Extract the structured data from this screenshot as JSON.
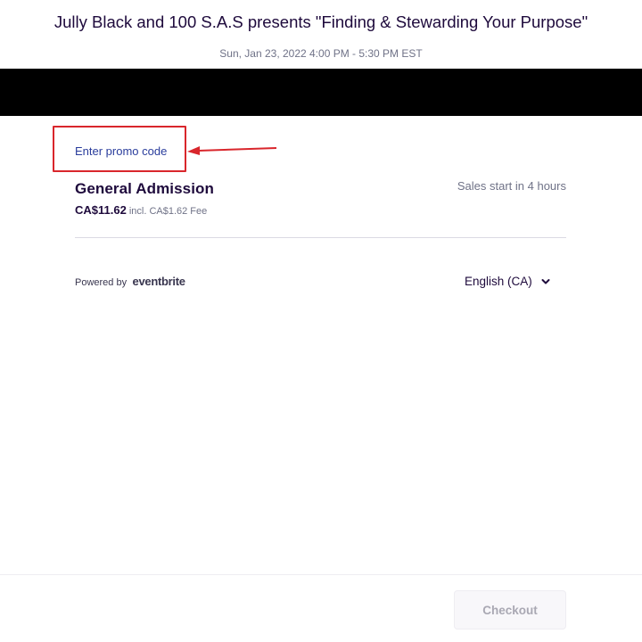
{
  "event": {
    "title": "Jully Black and 100 S.A.S presents \"Finding & Stewarding Your Purpose\"",
    "datetime": "Sun, Jan 23, 2022 4:00 PM - 5:30 PM EST"
  },
  "promo": {
    "link_label": "Enter promo code"
  },
  "tickets": [
    {
      "name": "General Admission",
      "price": "CA$11.62",
      "fee": "incl. CA$1.62 Fee",
      "status": "Sales start in 4 hours"
    }
  ],
  "footer_links": {
    "powered_by": "Powered by",
    "brand": "eventbrite"
  },
  "language": {
    "selected": "English (CA)",
    "icon": "chevron-down-icon"
  },
  "checkout": {
    "label": "Checkout"
  },
  "colors": {
    "annotation": "#d9262c",
    "link": "#2a3d9c",
    "banner": "#000000"
  }
}
